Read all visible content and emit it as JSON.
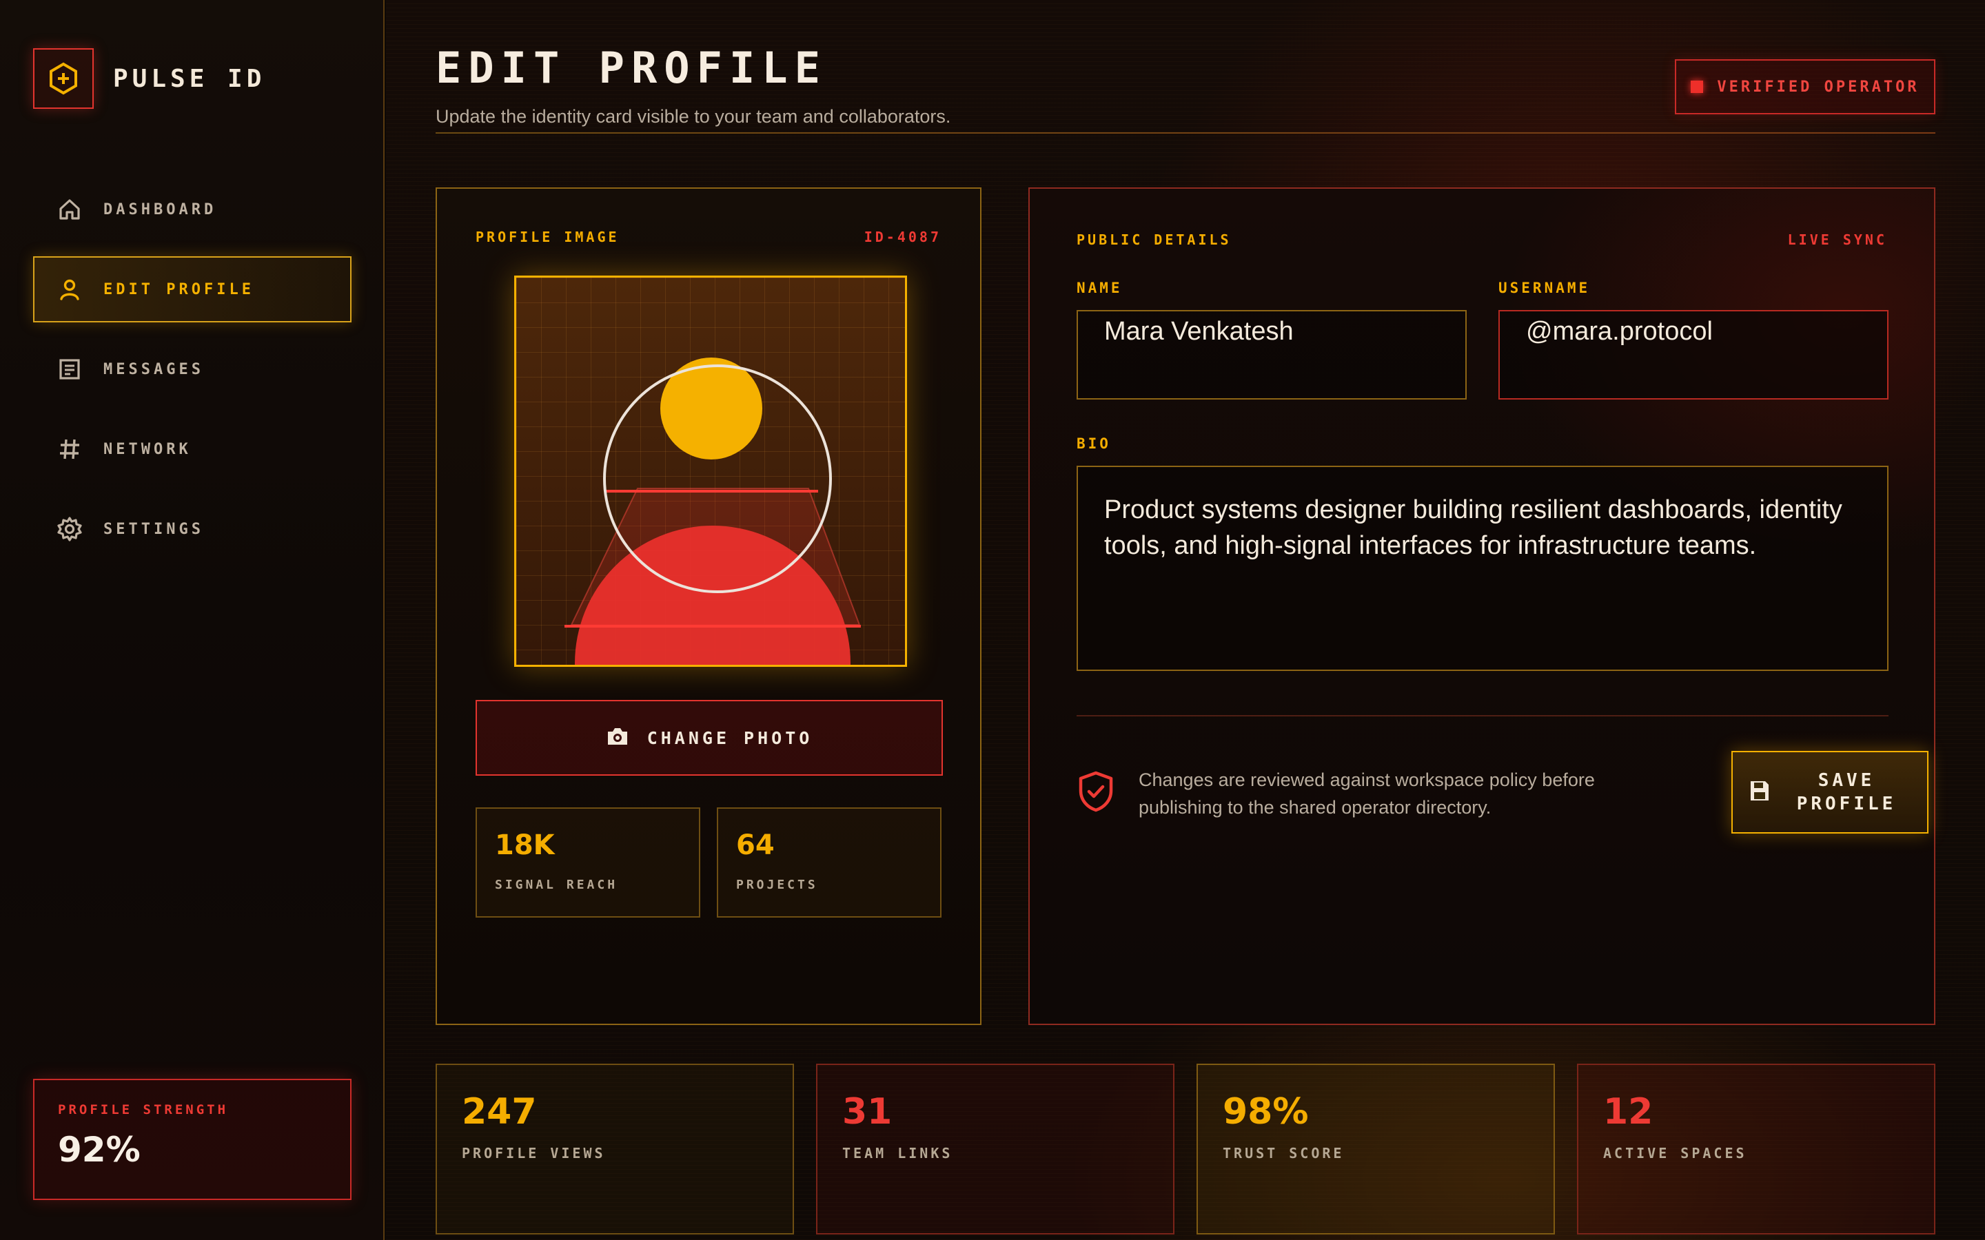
{
  "app": {
    "name": "PULSE ID"
  },
  "sidebar": {
    "items": [
      {
        "label": "DASHBOARD",
        "icon": "home-icon"
      },
      {
        "label": "EDIT PROFILE",
        "icon": "user-icon",
        "active": true
      },
      {
        "label": "MESSAGES",
        "icon": "messages-icon"
      },
      {
        "label": "NETWORK",
        "icon": "hash-icon"
      },
      {
        "label": "SETTINGS",
        "icon": "gear-icon"
      }
    ],
    "strength": {
      "label": "PROFILE STRENGTH",
      "value": "92%"
    }
  },
  "header": {
    "title": "EDIT PROFILE",
    "subtitle": "Update the identity card visible to your team and collaborators.",
    "badge": "VERIFIED OPERATOR"
  },
  "profile_image": {
    "label": "PROFILE IMAGE",
    "id": "ID-4087",
    "change_photo": "CHANGE PHOTO",
    "stats": [
      {
        "value": "18K",
        "label": "SIGNAL REACH"
      },
      {
        "value": "64",
        "label": "PROJECTS"
      }
    ]
  },
  "details": {
    "label": "PUBLIC DETAILS",
    "sync": "LIVE SYNC",
    "name_label": "NAME",
    "name_value": "Mara Venkatesh",
    "username_label": "USERNAME",
    "username_value": "@mara.protocol",
    "bio_label": "BIO",
    "bio_value": "Product systems designer building resilient dashboards, identity tools, and high-signal interfaces for infrastructure teams.",
    "policy": "Changes are reviewed against workspace policy before publishing to the shared operator directory.",
    "save_label": "SAVE PROFILE"
  },
  "stats": [
    {
      "value": "247",
      "label": "PROFILE VIEWS",
      "accent": "#f5ad00"
    },
    {
      "value": "31",
      "label": "TEAM LINKS",
      "accent": "#ee3a34"
    },
    {
      "value": "98%",
      "label": "TRUST SCORE",
      "accent": "#f5ad00"
    },
    {
      "value": "12",
      "label": "ACTIVE SPACES",
      "accent": "#ee3a34"
    }
  ],
  "colors": {
    "amber": "#f5b100",
    "red": "#e3342e",
    "background": "#0c0806"
  }
}
